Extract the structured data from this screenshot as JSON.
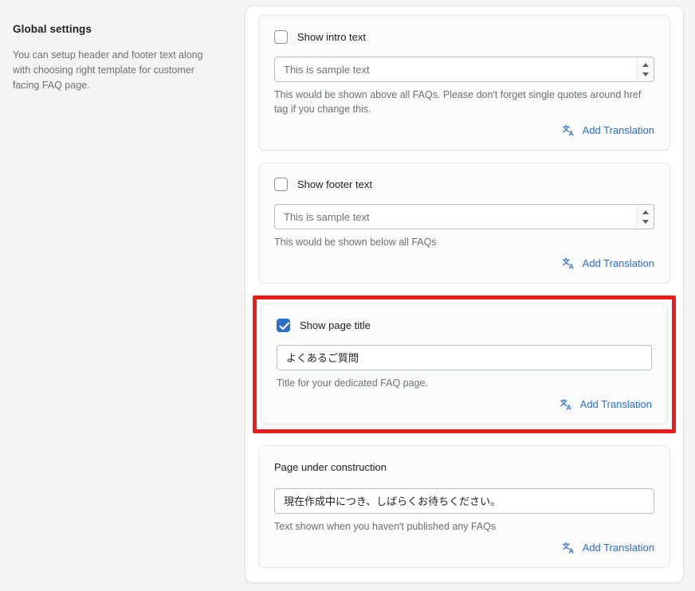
{
  "sidebar": {
    "title": "Global settings",
    "description": "You can setup header and footer text along with choosing right template for customer facing FAQ page."
  },
  "cards": [
    {
      "id": "intro-text",
      "checkbox_label": "Show intro text",
      "checked": false,
      "field_value": "This is sample text",
      "field_is_placeholder": true,
      "has_spinner": true,
      "help_text": "This would be shown above all FAQs. Please don't forget single quotes around href tag if you change this.",
      "translation_label": "Add Translation",
      "translation_icon": "translate-icon"
    },
    {
      "id": "footer-text",
      "checkbox_label": "Show footer text",
      "checked": false,
      "field_value": "This is sample text",
      "field_is_placeholder": true,
      "has_spinner": true,
      "help_text": "This would be shown below all FAQs",
      "translation_label": "Add Translation",
      "translation_icon": "translate-icon"
    },
    {
      "id": "page-title",
      "checkbox_label": "Show page title",
      "checked": true,
      "field_value": "よくあるご質問",
      "field_is_placeholder": false,
      "has_spinner": false,
      "help_text": "Title for your dedicated FAQ page.",
      "translation_label": "Add Translation",
      "translation_icon": "translate-icon",
      "highlighted": true
    },
    {
      "id": "page-under-construction",
      "plain_label": "Page under construction",
      "field_value": "現在作成中につき、しばらくお待ちください。",
      "field_is_placeholder": false,
      "has_spinner": false,
      "help_text": "Text shown when you haven't published any FAQs",
      "translation_label": "Add Translation",
      "translation_icon": "translate-icon"
    }
  ],
  "colors": {
    "accent": "#2c6ecb",
    "highlight_border": "#ee1c1c",
    "page_background": "#f4f4f4",
    "panel_background": "#ffffff",
    "card_background": "#fafbfb",
    "text_primary": "#202223",
    "text_secondary": "#6d7175"
  }
}
